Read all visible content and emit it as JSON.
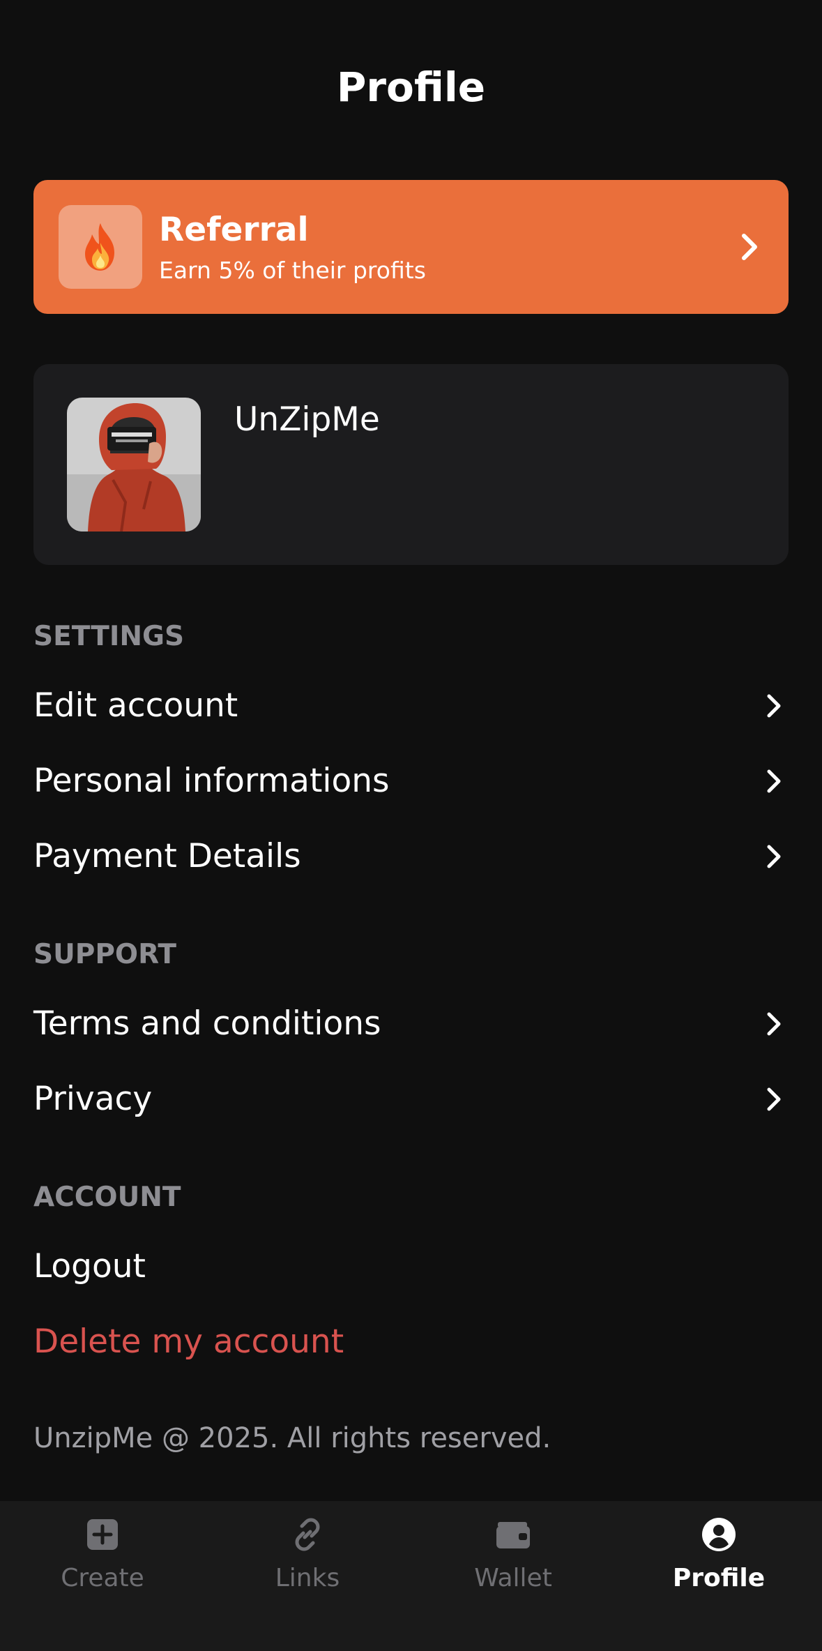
{
  "header": {
    "title": "Profile"
  },
  "referral": {
    "title": "Referral",
    "subtitle": "Earn 5% of their profits",
    "icon": "fire-icon",
    "color": "#ea6f3b"
  },
  "user": {
    "name": "UnZipMe"
  },
  "sections": {
    "settings": {
      "title": "SETTINGS",
      "items": [
        {
          "label": "Edit account"
        },
        {
          "label": "Personal informations"
        },
        {
          "label": "Payment Details"
        }
      ]
    },
    "support": {
      "title": "SUPPORT",
      "items": [
        {
          "label": "Terms and conditions"
        },
        {
          "label": "Privacy"
        }
      ]
    },
    "account": {
      "title": "ACCOUNT",
      "logout_label": "Logout",
      "delete_label": "Delete my account",
      "delete_color": "#d9534f"
    }
  },
  "footer": {
    "copyright": "UnzipMe @ 2025. All rights reserved."
  },
  "tabbar": {
    "active": "Profile",
    "tabs": [
      {
        "label": "Create",
        "icon": "plus-square-icon"
      },
      {
        "label": "Links",
        "icon": "link-icon"
      },
      {
        "label": "Wallet",
        "icon": "wallet-icon"
      },
      {
        "label": "Profile",
        "icon": "user-circle-icon"
      }
    ]
  }
}
